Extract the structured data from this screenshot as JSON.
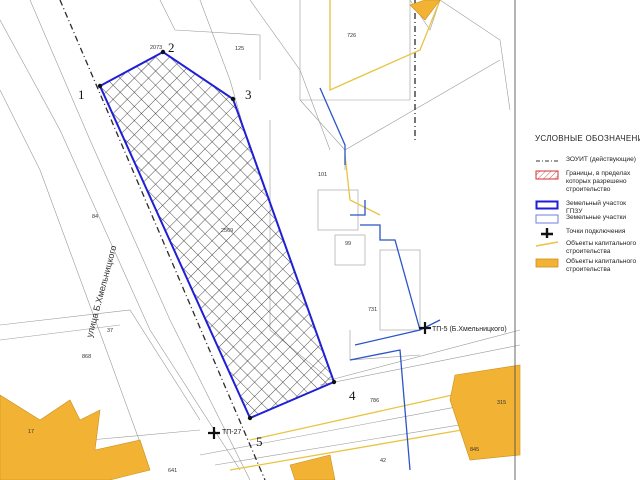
{
  "map": {
    "street_label": "улица Б.Хмельницкого",
    "point_labels": [
      "1",
      "2",
      "3",
      "4",
      "5"
    ],
    "parcel_numbers": [
      "2073",
      "125",
      "726",
      "101",
      "99",
      "731",
      "84",
      "37",
      "868",
      "17",
      "641",
      "2569",
      "786",
      "42",
      "845",
      "315"
    ],
    "connection_points": [
      "ТП-27",
      "ТП-5 (Б.Хмельницкого)"
    ]
  },
  "legend": {
    "title": "УСЛОВНЫЕ ОБОЗНАЧЕНИЯ",
    "items": [
      {
        "label": "ЗОУИТ (действующие)",
        "symbol": "dash-line"
      },
      {
        "label": "Границы, в пределах которых разрешено строительство объектов капитального строительства",
        "symbol": "hatched-red"
      },
      {
        "label": "Земельный участок ГПЗУ",
        "symbol": "blue-thick"
      },
      {
        "label": "Земельные участки",
        "symbol": "blue-thin"
      },
      {
        "label": "Точки подключения",
        "symbol": "cross"
      },
      {
        "label": "Объекты капитального строительства (линейные)",
        "symbol": "yellow-line"
      },
      {
        "label": "Объекты капитального строительства (действующие-площадные)",
        "symbol": "orange-fill"
      }
    ]
  },
  "colors": {
    "parcel_border": "#1f1fd6",
    "build_zone_border": "#e03030",
    "building_fill": "#f2b233",
    "linear_object": "#e8c440",
    "street_line": "#3a3a3a"
  }
}
